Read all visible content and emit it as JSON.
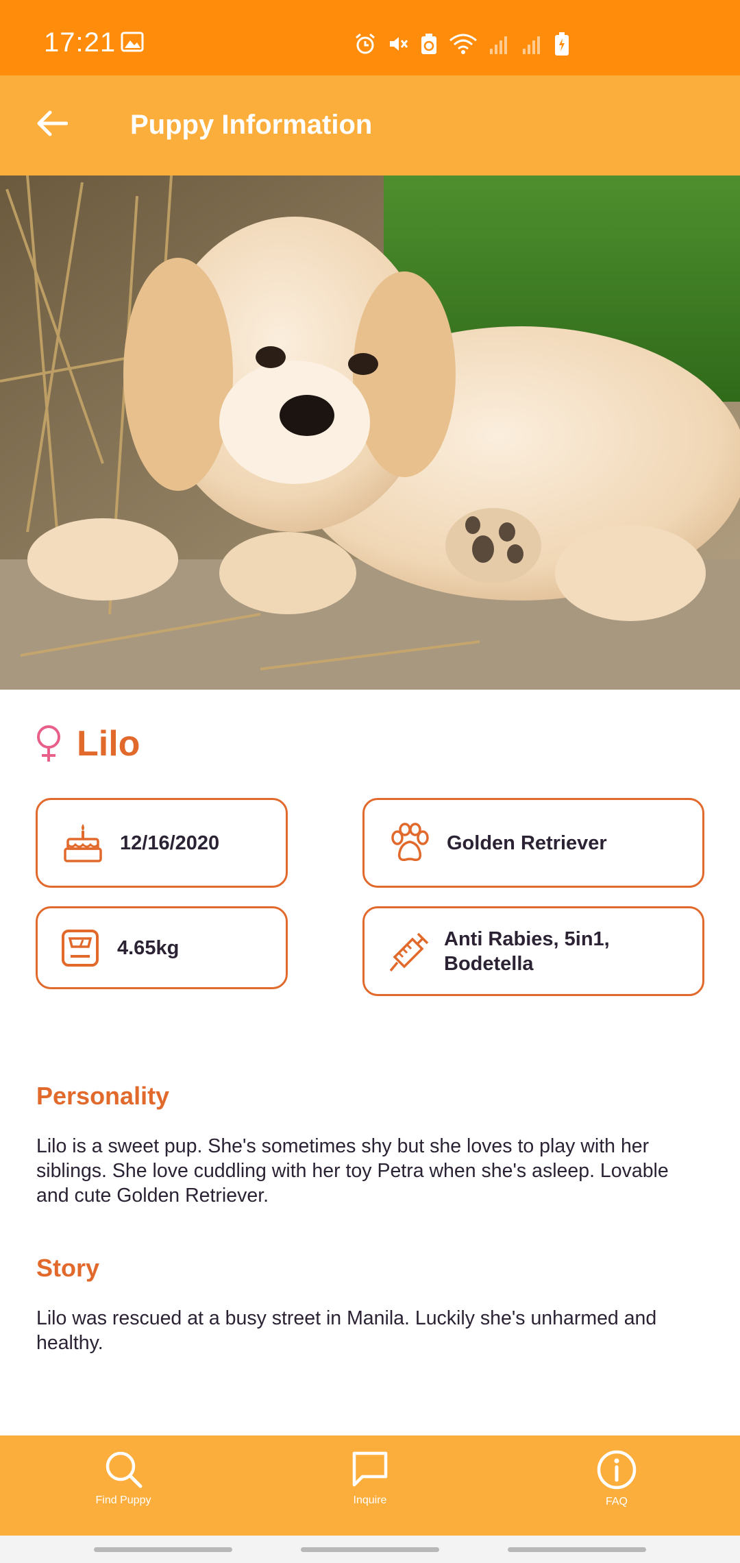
{
  "status_bar": {
    "time": "17:21",
    "icons": [
      "image-icon",
      "alarm-icon",
      "mute-icon",
      "recycle-icon",
      "wifi-icon",
      "signal-icon",
      "signal-icon",
      "battery-charging-icon"
    ]
  },
  "app_bar": {
    "title": "Puppy Information",
    "back_icon": "arrow-left-icon"
  },
  "puppy": {
    "name": "Lilo",
    "gender_icon": "female-icon",
    "birthday": "12/16/2020",
    "breed": "Golden Retriever",
    "weight": "4.65kg",
    "vaccines_line1": "Anti Rabies, 5in1,",
    "vaccines_line2": "Bodetella"
  },
  "sections": {
    "personality_title": "Personality",
    "personality_body": "Lilo is a sweet pup. She's sometimes shy but she loves to play with her siblings. She love cuddling with her toy Petra when she's asleep. Lovable and cute Golden Retriever.",
    "story_title": "Story",
    "story_body": "Lilo was rescued at a busy street in Manila. Luckily she's unharmed and healthy."
  },
  "bottom_nav": {
    "items": [
      {
        "label": "Find Puppy",
        "icon": "search-icon"
      },
      {
        "label": "Inquire",
        "icon": "chat-icon"
      },
      {
        "label": "FAQ",
        "icon": "info-icon"
      }
    ]
  },
  "colors": {
    "status_bar": "#ff8c0a",
    "app_bar": "#fcae3c",
    "accent": "#e2692c",
    "text": "#2b2233"
  }
}
